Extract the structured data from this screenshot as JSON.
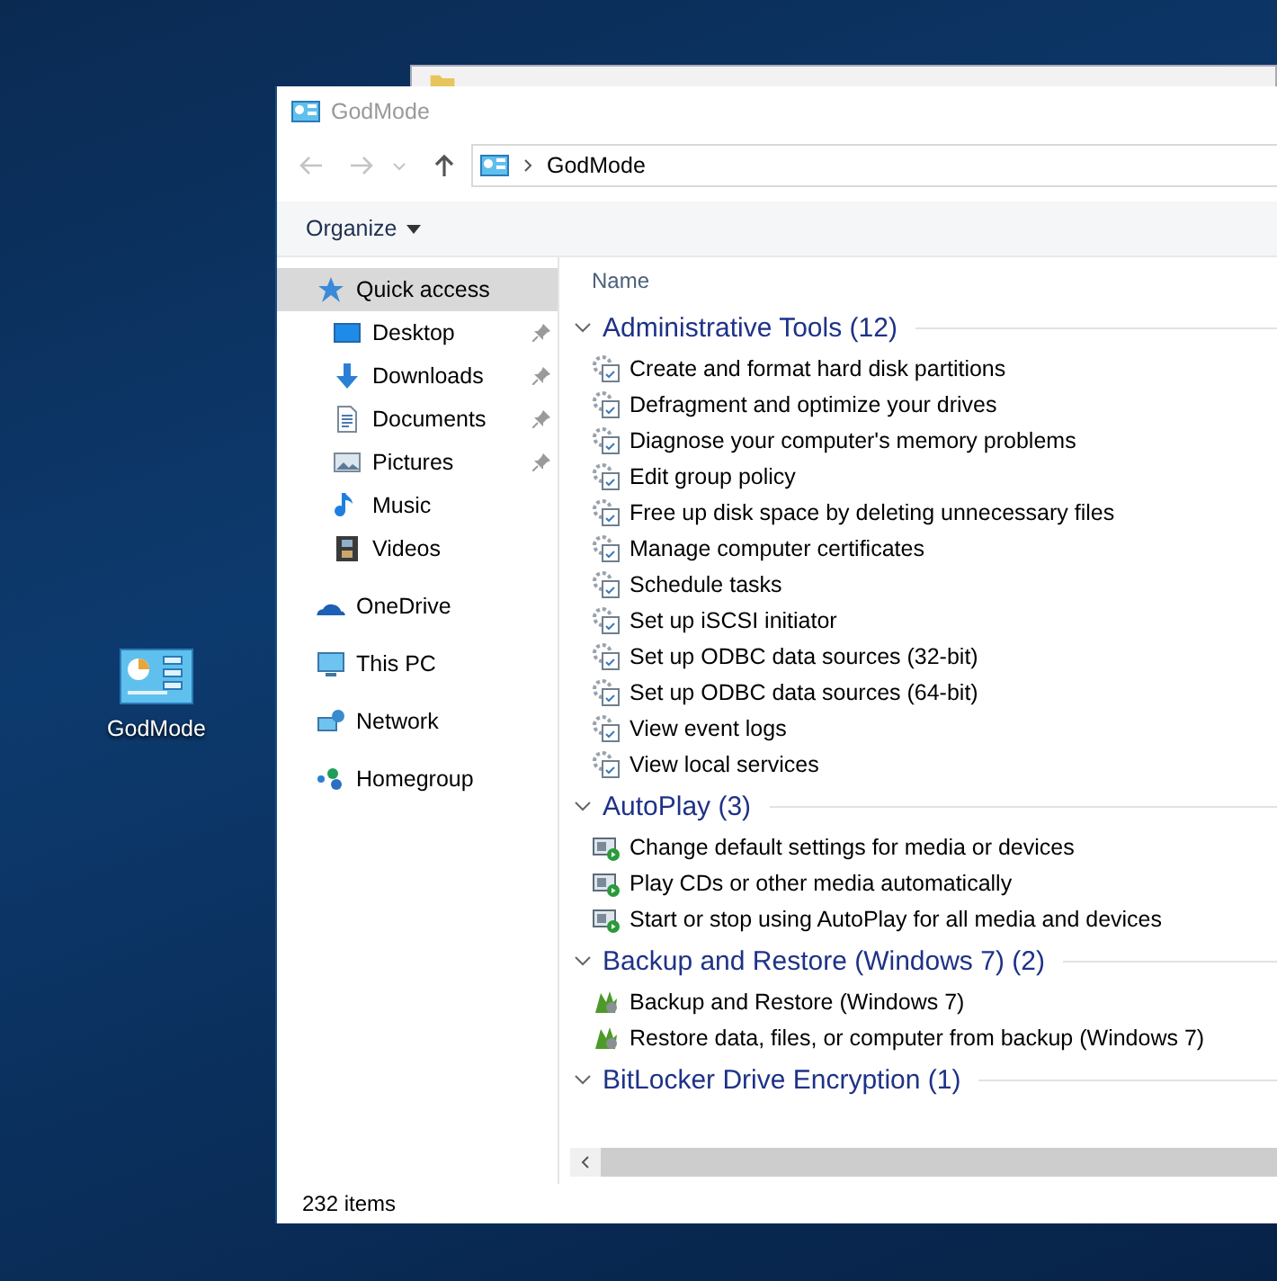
{
  "desktop": {
    "icons": [
      {
        "label": "GodMode"
      }
    ]
  },
  "window": {
    "title": "GodMode",
    "address": {
      "path": [
        "GodMode"
      ]
    },
    "toolbar": {
      "organize": "Organize"
    },
    "sidebar": {
      "items": [
        {
          "label": "Quick access",
          "kind": "star",
          "selected": true,
          "pinned": false,
          "children": [
            {
              "label": "Desktop",
              "kind": "desktop",
              "selected": false,
              "pinned": true
            },
            {
              "label": "Downloads",
              "kind": "download",
              "selected": false,
              "pinned": true
            },
            {
              "label": "Documents",
              "kind": "document",
              "selected": false,
              "pinned": true
            },
            {
              "label": "Pictures",
              "kind": "picture",
              "selected": false,
              "pinned": true
            },
            {
              "label": "Music",
              "kind": "music",
              "selected": false,
              "pinned": false
            },
            {
              "label": "Videos",
              "kind": "video",
              "selected": false,
              "pinned": false
            }
          ]
        },
        {
          "label": "OneDrive",
          "kind": "cloud",
          "selected": false,
          "pinned": false
        },
        {
          "label": "This PC",
          "kind": "pc",
          "selected": false,
          "pinned": false
        },
        {
          "label": "Network",
          "kind": "network",
          "selected": false,
          "pinned": false
        },
        {
          "label": "Homegroup",
          "kind": "homegroup",
          "selected": false,
          "pinned": false
        }
      ]
    },
    "content": {
      "columns": [
        "Name"
      ],
      "groups": [
        {
          "title": "Administrative Tools (12)",
          "kind": "admin",
          "expanded": true,
          "items": [
            "Create and format hard disk partitions",
            "Defragment and optimize your drives",
            "Diagnose your computer's memory problems",
            "Edit group policy",
            "Free up disk space by deleting unnecessary files",
            "Manage computer certificates",
            "Schedule tasks",
            "Set up iSCSI initiator",
            "Set up ODBC data sources (32-bit)",
            "Set up ODBC data sources (64-bit)",
            "View event logs",
            "View local services"
          ]
        },
        {
          "title": "AutoPlay (3)",
          "kind": "autoplay",
          "expanded": true,
          "items": [
            "Change default settings for media or devices",
            "Play CDs or other media automatically",
            "Start or stop using AutoPlay for all media and devices"
          ]
        },
        {
          "title": "Backup and Restore (Windows 7) (2)",
          "kind": "backup",
          "expanded": true,
          "items": [
            "Backup and Restore (Windows 7)",
            "Restore data, files, or computer from backup (Windows 7)"
          ]
        },
        {
          "title": "BitLocker Drive Encryption (1)",
          "expanded": true
        }
      ]
    },
    "status_bar": {
      "count": "232 items"
    }
  }
}
